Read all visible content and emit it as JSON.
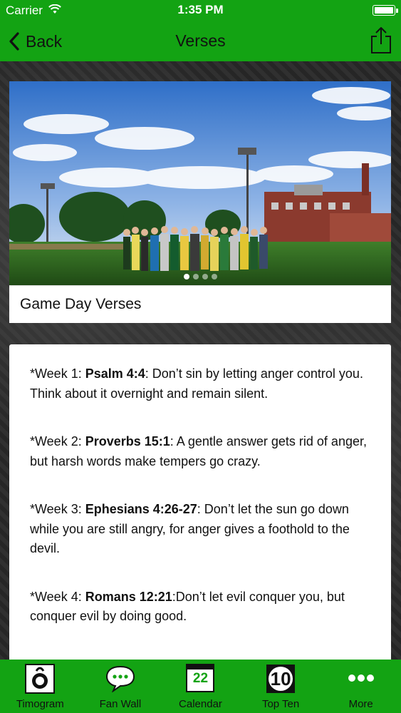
{
  "status_bar": {
    "carrier": "Carrier",
    "time": "1:35 PM"
  },
  "nav": {
    "back_label": "Back",
    "title": "Verses"
  },
  "gallery": {
    "caption": "Game Day Verses",
    "page_count": 4,
    "current_page": 1
  },
  "verses": [
    {
      "prefix": "*Week 1: ",
      "ref": "Psalm 4:4",
      "text": ": Don’t sin by letting anger control you. Think about it overnight and remain silent."
    },
    {
      "prefix": "*Week 2: ",
      "ref": "Proverbs 15:1",
      "text": ": A gentle answer gets rid of anger, but harsh words make tempers go crazy."
    },
    {
      "prefix": "*Week 3: ",
      "ref": "Ephesians 4:26-27",
      "text": ":  Don’t let the sun go down while you are still angry, for anger gives a foothold to the devil."
    },
    {
      "prefix": "*Week 4: ",
      "ref": "Romans 12:21",
      "text": ":Don’t let evil conquer you, but conquer evil by doing good."
    }
  ],
  "tabs": [
    {
      "label": "Timogram",
      "icon": "camera-icon"
    },
    {
      "label": "Fan Wall",
      "icon": "chat-bubble-icon"
    },
    {
      "label": "Calendar",
      "icon": "calendar-icon",
      "badge": "22"
    },
    {
      "label": "Top Ten",
      "icon": "top-ten-icon",
      "badge": "10"
    },
    {
      "label": "More",
      "icon": "more-icon"
    }
  ],
  "colors": {
    "brand_green": "#13a313",
    "card_white": "#ffffff",
    "text_dark": "#111111"
  }
}
